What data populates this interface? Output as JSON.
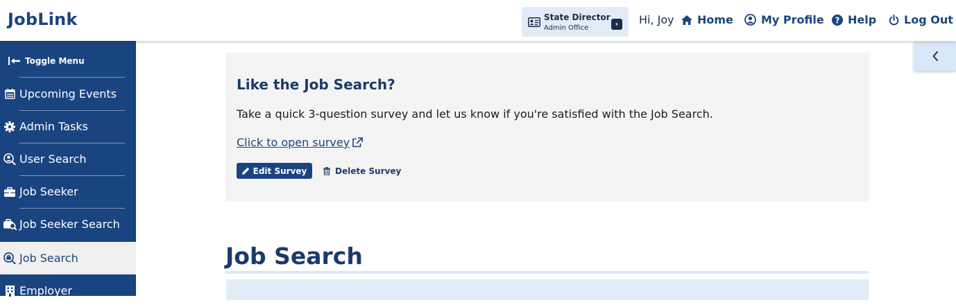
{
  "header": {
    "logo": "JobLink",
    "role": {
      "title": "State Director",
      "subtitle": "Admin Office"
    },
    "greeting": "Hi, Joy",
    "nav": {
      "home": "Home",
      "profile": "My Profile",
      "help": "Help",
      "logout": "Log Out"
    }
  },
  "sidebar": {
    "toggle_label": "Toggle Menu",
    "items": [
      {
        "label": "Upcoming Events",
        "icon": "calendar-icon"
      },
      {
        "label": "Admin Tasks",
        "icon": "gear-icon"
      },
      {
        "label": "User Search",
        "icon": "user-search-icon"
      },
      {
        "label": "Job Seeker",
        "icon": "briefcase-icon"
      },
      {
        "label": "Job Seeker Search",
        "icon": "briefcase-search-icon"
      },
      {
        "label": "Job Search",
        "icon": "search-icon",
        "active": true
      },
      {
        "label": "Employer",
        "icon": "building-icon"
      }
    ]
  },
  "survey": {
    "title": "Like the Job Search?",
    "description": "Take a quick 3-question survey and let us know if you're satisfied with the Job Search.",
    "link": "Click to open survey",
    "edit_label": "Edit Survey",
    "delete_label": "Delete Survey"
  },
  "main": {
    "title": "Job Search"
  },
  "colors": {
    "brand": "#1a4480",
    "active_bg": "#f0f0f0",
    "card_bg": "#f4f4f4",
    "light_blue": "#e1ecf8"
  }
}
